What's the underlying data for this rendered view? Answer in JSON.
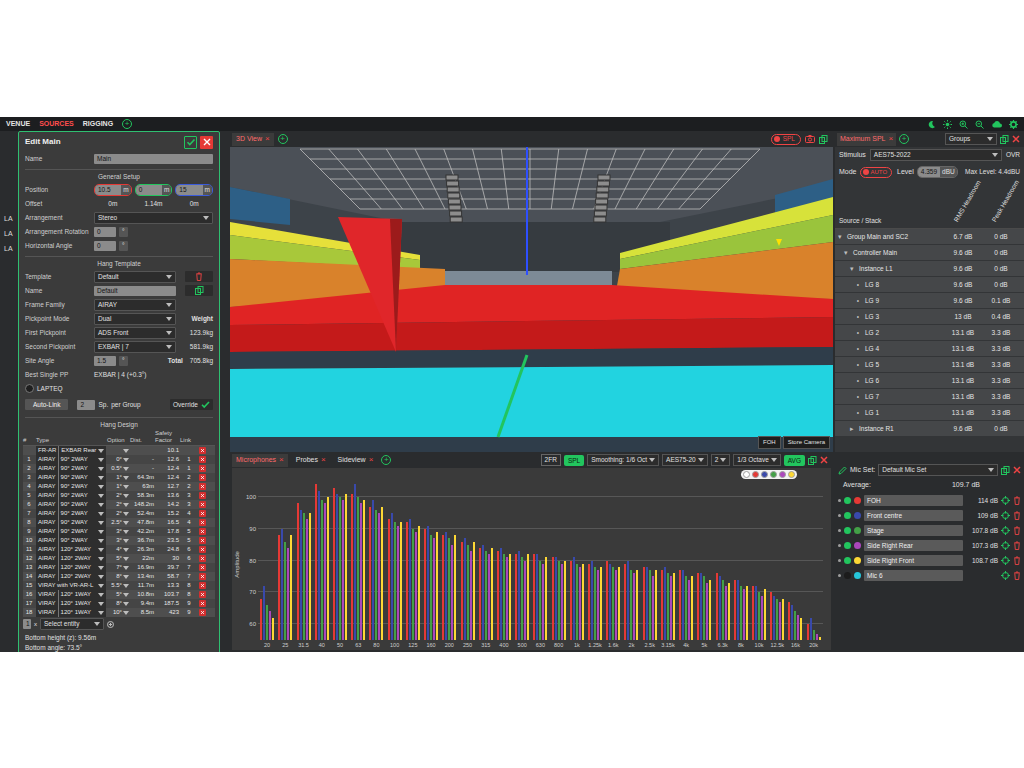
{
  "nav": {
    "tabs": [
      {
        "label": "VENUE",
        "selected": false
      },
      {
        "label": "SOURCES",
        "selected": true
      },
      {
        "label": "RIGGING",
        "selected": false
      }
    ],
    "add": "+"
  },
  "behind": [
    "LA",
    "LA",
    "LA"
  ],
  "edit": {
    "title": "Edit Main",
    "name": {
      "label": "Name",
      "value": "Main"
    },
    "general_setup": "General Setup",
    "position": {
      "label": "Position",
      "values": [
        {
          "value": "10.5",
          "unit": "m",
          "color": "#e53935"
        },
        {
          "value": "0",
          "unit": "m",
          "color": "#22c55e"
        },
        {
          "value": "15",
          "unit": "m",
          "color": "#3b5bdb"
        }
      ]
    },
    "offset": {
      "label": "Offset",
      "values": [
        "0m",
        "1.14m",
        "0m"
      ]
    },
    "arrangement": {
      "label": "Arrangement",
      "value": "Stereo"
    },
    "arrangement_rotation": {
      "label": "Arrangement Rotation",
      "value": "0",
      "unit": "°"
    },
    "horizontal_angle": {
      "label": "Horizontal Angle",
      "value": "0",
      "unit": "°"
    },
    "hang_template": "Hang Template",
    "template": {
      "label": "Template",
      "value": "Default"
    },
    "template_name": {
      "label": "Name",
      "value": "Default"
    },
    "frame_family": {
      "label": "Frame Family",
      "value": "AIRAY"
    },
    "pickpoint_mode": {
      "label": "Pickpoint Mode",
      "value": "Dual",
      "aside": "Weight"
    },
    "first_pickpoint": {
      "label": "First Pickpoint",
      "value": "ADS Front",
      "aside": "123.9kg"
    },
    "second_pickpoint": {
      "label": "Second Pickpoint",
      "value": "EXBAR | 7",
      "aside": "581.9kg"
    },
    "site_angle": {
      "label": "Site Angle",
      "value": "1.5",
      "unit": "°",
      "aside_label": "Total",
      "aside": "705.8kg"
    },
    "best_single_pp": {
      "label": "Best Single PP",
      "value": "EXBAR | 4 (+0.3°)"
    },
    "lapteq": {
      "label": "LAPTEQ",
      "on": false
    },
    "autolink": {
      "button": "Auto-Link",
      "count": "2",
      "unit": "Sp.",
      "per": "per Group",
      "override": "Override",
      "override_checked": true
    },
    "hang_design": "Hang Design",
    "columns": [
      "#",
      "Type",
      "Option",
      "Dist.",
      "Safety Factor",
      "Link"
    ],
    "rows": [
      {
        "n": "",
        "type": "FR-AR",
        "model": "EXBAR Rear",
        "option": "",
        "dist": "",
        "sf": "10.1",
        "link": ""
      },
      {
        "n": "1",
        "type": "AIRAY",
        "model": "90° 2WAY",
        "option": "0°",
        "dist": "-",
        "sf": "12.6",
        "link": "1"
      },
      {
        "n": "2",
        "type": "AIRAY",
        "model": "90° 2WAY",
        "option": "0.5°",
        "dist": "-",
        "sf": "12.4",
        "link": "1"
      },
      {
        "n": "3",
        "type": "AIRAY",
        "model": "90° 2WAY",
        "option": "1°",
        "dist": "64.3m",
        "sf": "12.4",
        "link": "2"
      },
      {
        "n": "4",
        "type": "AIRAY",
        "model": "90° 2WAY",
        "option": "1°",
        "dist": "63m",
        "sf": "12.7",
        "link": "2"
      },
      {
        "n": "5",
        "type": "AIRAY",
        "model": "90° 2WAY",
        "option": "2°",
        "dist": "58.3m",
        "sf": "13.6",
        "link": "3"
      },
      {
        "n": "6",
        "type": "AIRAY",
        "model": "90° 2WAY",
        "option": "2°",
        "dist": "148.2m",
        "sf": "14.2",
        "link": "3"
      },
      {
        "n": "7",
        "type": "AIRAY",
        "model": "90° 2WAY",
        "option": "2°",
        "dist": "52.4m",
        "sf": "15.2",
        "link": "4"
      },
      {
        "n": "8",
        "type": "AIRAY",
        "model": "90° 2WAY",
        "option": "2.5°",
        "dist": "47.8m",
        "sf": "16.5",
        "link": "4"
      },
      {
        "n": "9",
        "type": "AIRAY",
        "model": "90° 2WAY",
        "option": "3°",
        "dist": "42.2m",
        "sf": "17.8",
        "link": "5"
      },
      {
        "n": "10",
        "type": "AIRAY",
        "model": "90° 2WAY",
        "option": "3°",
        "dist": "36.7m",
        "sf": "23.5",
        "link": "5"
      },
      {
        "n": "11",
        "type": "AIRAY",
        "model": "120° 2WAY",
        "option": "4°",
        "dist": "26.3m",
        "sf": "24.8",
        "link": "6"
      },
      {
        "n": "12",
        "type": "AIRAY",
        "model": "120° 2WAY",
        "option": "5°",
        "dist": "22m",
        "sf": "30",
        "link": "6"
      },
      {
        "n": "13",
        "type": "AIRAY",
        "model": "120° 2WAY",
        "option": "7°",
        "dist": "16.9m",
        "sf": "39.7",
        "link": "7"
      },
      {
        "n": "14",
        "type": "AIRAY",
        "model": "120° 2WAY",
        "option": "8°",
        "dist": "13.4m",
        "sf": "58.7",
        "link": "7"
      },
      {
        "n": "15",
        "type": "VIRAY with VR-AR-L",
        "model": "",
        "option": "5.5°",
        "dist": "11.7m",
        "sf": "13.3",
        "link": "8"
      },
      {
        "n": "16",
        "type": "VIRAY",
        "model": "120° 1WAY",
        "option": "5°",
        "dist": "10.8m",
        "sf": "103.7",
        "link": "8"
      },
      {
        "n": "17",
        "type": "VIRAY",
        "model": "120° 1WAY",
        "option": "8°",
        "dist": "9.4m",
        "sf": "187.5",
        "link": "9"
      },
      {
        "n": "18",
        "type": "VIRAY",
        "model": "120° 1WAY",
        "option": "10°",
        "dist": "8.5m",
        "sf": "423",
        "link": "9"
      }
    ],
    "select": {
      "count": "1",
      "x": "x",
      "placeholder": "Select entity"
    },
    "bottom_height": "Bottom height (z): 9.56m",
    "bottom_angle": "Bottom angle: 73.5°"
  },
  "view": {
    "tab": "3D View",
    "close": "×",
    "add": "+",
    "spl": {
      "label": "SPL",
      "on": true
    },
    "buttons": [
      "FOH",
      "Store Camera"
    ]
  },
  "spl": {
    "title": "Maximum SPL",
    "close": "×",
    "add": "+",
    "groups": "Groups",
    "stimulus_label": "Stimulus",
    "stimulus": "AES75-2022",
    "ovr": "OVR",
    "mode_label": "Mode",
    "mode": "AUTO",
    "mode_on": true,
    "level_label": "Level",
    "level": "4.359",
    "level_unit": "dBU",
    "max_level": "Max Level: 4.4dBU",
    "columns": [
      "Source / Stack",
      "RMS Headroom",
      "Peak Headroom"
    ],
    "rows": [
      {
        "icon": "▾",
        "name": "Group Main and SC2",
        "rms": "6.7 dB",
        "peak": "0 dB",
        "depth": 0
      },
      {
        "icon": "▾",
        "name": "Controller Main",
        "rms": "9.6 dB",
        "peak": "0 dB",
        "depth": 1
      },
      {
        "icon": "▾",
        "name": "Instance L1",
        "rms": "9.6 dB",
        "peak": "0 dB",
        "depth": 2
      },
      {
        "icon": "•",
        "name": "LG 8",
        "rms": "9.6 dB",
        "peak": "0 dB",
        "depth": 3
      },
      {
        "icon": "•",
        "name": "LG 9",
        "rms": "9.6 dB",
        "peak": "0.1 dB",
        "depth": 3
      },
      {
        "icon": "•",
        "name": "LG 3",
        "rms": "13 dB",
        "peak": "0.4 dB",
        "depth": 3
      },
      {
        "icon": "•",
        "name": "LG 2",
        "rms": "13.1 dB",
        "peak": "3.3 dB",
        "depth": 3
      },
      {
        "icon": "•",
        "name": "LG 4",
        "rms": "13.1 dB",
        "peak": "3.3 dB",
        "depth": 3
      },
      {
        "icon": "•",
        "name": "LG 5",
        "rms": "13.1 dB",
        "peak": "3.3 dB",
        "depth": 3
      },
      {
        "icon": "•",
        "name": "LG 6",
        "rms": "13.1 dB",
        "peak": "3.3 dB",
        "depth": 3
      },
      {
        "icon": "•",
        "name": "LG 7",
        "rms": "13.1 dB",
        "peak": "3.3 dB",
        "depth": 3
      },
      {
        "icon": "•",
        "name": "LG 1",
        "rms": "13.1 dB",
        "peak": "3.3 dB",
        "depth": 3
      },
      {
        "icon": "▸",
        "name": "Instance R1",
        "rms": "9.6 dB",
        "peak": "0 dB",
        "depth": 2
      }
    ]
  },
  "bottom": {
    "tabs": [
      {
        "label": "Microphones",
        "selected": true
      },
      {
        "label": "Probes",
        "selected": false
      },
      {
        "label": "Sideview",
        "selected": false
      }
    ],
    "close": "×",
    "add": "+",
    "controls": {
      "fr": "2FR",
      "spl": {
        "label": "SPL",
        "on": true
      },
      "smoothing": "Smoothing:",
      "smoothing_value": "1/6 Oct",
      "stimulus": "AES75-20",
      "count": "2",
      "band": "1/3 Octave",
      "avg": {
        "label": "AVG",
        "on": true
      }
    }
  },
  "chart": {
    "y_title": "Amplitude",
    "y_ticks": [
      "100",
      "90",
      "80",
      "70",
      "60"
    ],
    "x_labels": [
      "20",
      "25",
      "31.5",
      "40",
      "50",
      "63",
      "80",
      "100",
      "125",
      "160",
      "200",
      "250",
      "315",
      "400",
      "500",
      "630",
      "800",
      "1k",
      "1.25k",
      "1.6k",
      "2k",
      "2.5k",
      "3.15k",
      "4k",
      "5k",
      "6.3k",
      "8k",
      "10k",
      "12.5k",
      "16k",
      "20k"
    ],
    "legend": [
      {
        "color": "#ffffff"
      },
      {
        "color": "#e53935"
      },
      {
        "color": "#3949ab"
      },
      {
        "color": "#43a047"
      },
      {
        "color": "#ab47bc"
      },
      {
        "color": "#fdd835"
      }
    ],
    "series": [
      {
        "color": "#e53935",
        "values": [
          68,
          88,
          98,
          104,
          103,
          101,
          97,
          93,
          92,
          90,
          88,
          86,
          84,
          83,
          82,
          82,
          81,
          80,
          79,
          80,
          79,
          78,
          77,
          77,
          76,
          76,
          74,
          72,
          70,
          67,
          60
        ]
      },
      {
        "color": "#3949ab",
        "values": [
          72,
          90,
          96,
          102,
          101,
          104,
          99,
          95,
          93,
          91,
          89,
          87,
          85,
          84,
          83,
          82,
          81,
          81,
          80,
          79,
          80,
          78,
          78,
          77,
          76,
          75,
          74,
          72,
          69,
          66,
          62
        ]
      },
      {
        "color": "#43a047",
        "values": [
          66,
          86,
          95,
          99,
          100,
          100,
          96,
          92,
          90,
          88,
          87,
          85,
          83,
          82,
          81,
          80,
          80,
          79,
          78,
          78,
          77,
          77,
          76,
          75,
          75,
          74,
          72,
          70,
          68,
          64,
          58
        ]
      },
      {
        "color": "#ab47bc",
        "values": [
          64,
          84,
          93,
          98,
          99,
          98,
          95,
          91,
          89,
          87,
          85,
          83,
          82,
          81,
          80,
          79,
          79,
          78,
          77,
          77,
          76,
          75,
          75,
          74,
          73,
          72,
          71,
          69,
          67,
          63,
          57
        ]
      },
      {
        "color": "#fdd835",
        "values": [
          62,
          88,
          95,
          100,
          101,
          99,
          97,
          92,
          91,
          89,
          88,
          86,
          84,
          82,
          82,
          81,
          80,
          79,
          78,
          78,
          77,
          77,
          76,
          75,
          74,
          73,
          72,
          71,
          68,
          62,
          56
        ]
      }
    ]
  },
  "micset": {
    "label": "Mic Set:",
    "value": "Default Mic Set",
    "average_label": "Average:",
    "average": "109.7 dB",
    "mics": [
      {
        "name": "FOH",
        "value": "114 dB",
        "color": "#e53935",
        "enabled": true
      },
      {
        "name": "Front centre",
        "value": "109 dB",
        "color": "#3949ab",
        "enabled": true
      },
      {
        "name": "Stage",
        "value": "107.8 dB",
        "color": "#43a047",
        "enabled": true
      },
      {
        "name": "Side Right Rear",
        "value": "107.3 dB",
        "color": "#ab47bc",
        "enabled": true
      },
      {
        "name": "Side Right Front",
        "value": "108.7 dB",
        "color": "#fdd835",
        "enabled": true
      },
      {
        "name": "Mic 6",
        "value": "",
        "color": "#26c6da",
        "enabled": false
      }
    ]
  }
}
